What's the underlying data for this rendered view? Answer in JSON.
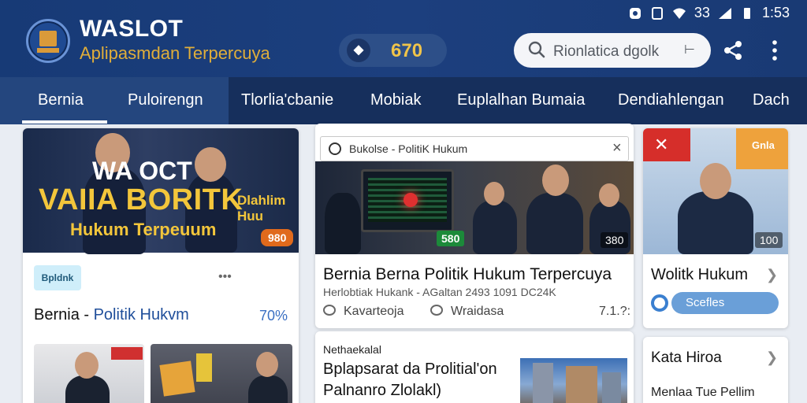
{
  "status_bar": {
    "time": "1:53",
    "signal": "33"
  },
  "app": {
    "title": "WASLOT",
    "subtitle": "Aplipasmdan Terpercuya"
  },
  "coins": {
    "value": "670"
  },
  "search": {
    "placeholder": "Rionlatica dgolk"
  },
  "tabs": [
    {
      "label": "Bernia"
    },
    {
      "label": "Puloirengn"
    },
    {
      "label": "Tlorlia'cbanie"
    },
    {
      "label": "Mobiak"
    },
    {
      "label": "Euplalhan Bumaia"
    },
    {
      "label": "Dendiahlengan"
    },
    {
      "label": "Dach"
    }
  ],
  "card1": {
    "hero_top": "WA OCT",
    "hero_big": "VAIIA BORITK",
    "hero_sub": "Hukum Terpeuum",
    "hero_side": "Dlahlim Huu",
    "badge": "980",
    "chip": "Bpldnk",
    "title_a": "Bernia",
    "title_b": "Politik Hukvm",
    "percent": "70%"
  },
  "card2": {
    "popup_title": "Bukolse - PolitiK Hukum",
    "badge_green": "580",
    "badge_dark": "380",
    "title": "Bernia Berna Politik Hukum Terpercuya",
    "meta": "Herlobtiak Hukank - AGaltan 2493 1091 DC24K",
    "action_1": "Kavarteoja",
    "action_2": "Wraidasa",
    "count": "7.1.?:"
  },
  "card3": {
    "kicker": "Nethaekalal",
    "title_line1": "Bplapsarat da Prolitial'on",
    "title_line2": "Palnanro Zlolakl)"
  },
  "card4": {
    "tag": "Gnla",
    "badge": "100",
    "title": "Wolitk Hukum",
    "pill": "Scefles"
  },
  "card5": {
    "title": "Kata Hiroa",
    "subtitle": "Menlaa Tue Pellim"
  }
}
